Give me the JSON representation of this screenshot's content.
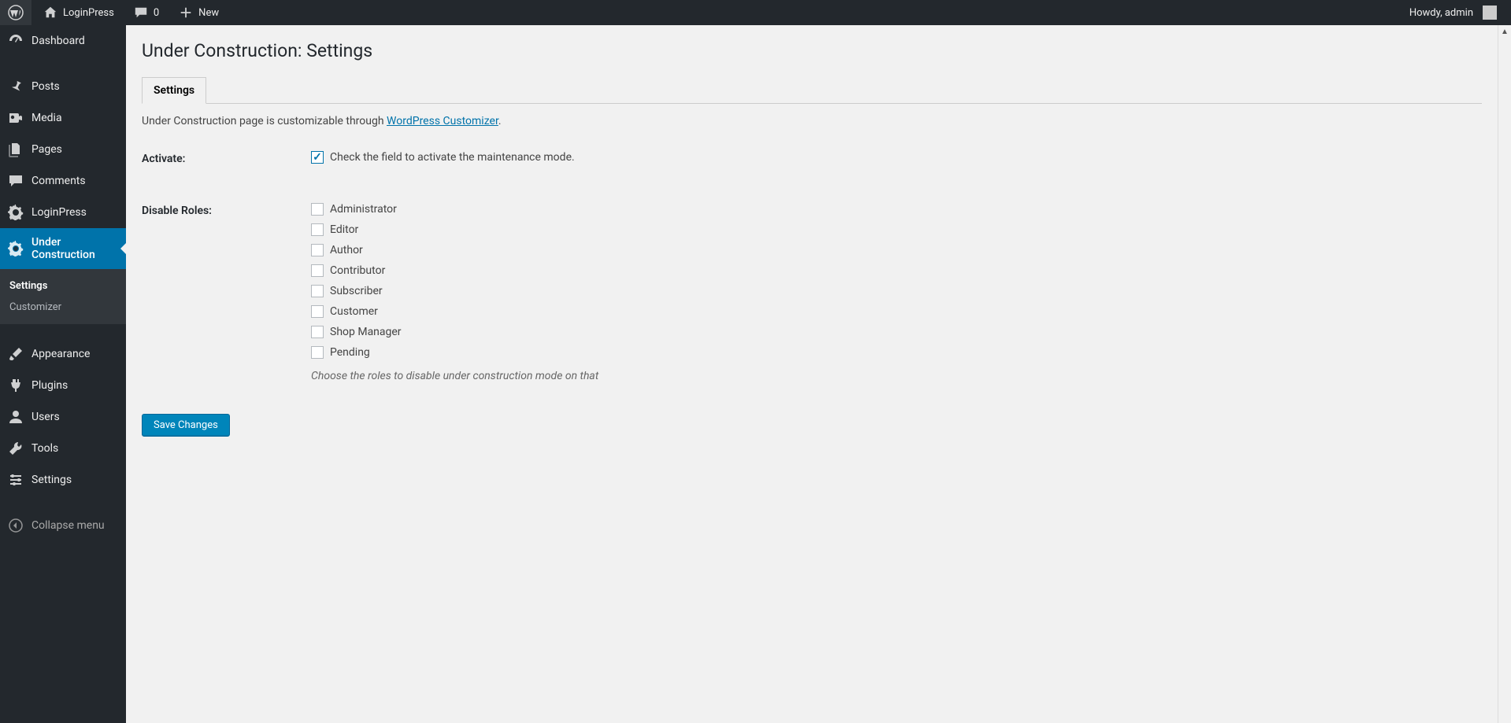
{
  "adminbar": {
    "site_name": "LoginPress",
    "comment_count": "0",
    "new_label": "New",
    "howdy": "Howdy, admin"
  },
  "sidebar": {
    "items": [
      {
        "label": "Dashboard",
        "icon": "dashboard",
        "slug": "dashboard"
      },
      {
        "label": "Posts",
        "icon": "pin",
        "slug": "posts"
      },
      {
        "label": "Media",
        "icon": "media",
        "slug": "media"
      },
      {
        "label": "Pages",
        "icon": "pages",
        "slug": "pages"
      },
      {
        "label": "Comments",
        "icon": "comment",
        "slug": "comments"
      },
      {
        "label": "LoginPress",
        "icon": "gear",
        "slug": "loginpress"
      },
      {
        "label": "Under Construction",
        "icon": "gear",
        "slug": "under-construction",
        "current": true
      },
      {
        "label": "Appearance",
        "icon": "brush",
        "slug": "appearance"
      },
      {
        "label": "Plugins",
        "icon": "plugin",
        "slug": "plugins"
      },
      {
        "label": "Users",
        "icon": "users",
        "slug": "users"
      },
      {
        "label": "Tools",
        "icon": "tools",
        "slug": "tools"
      },
      {
        "label": "Settings",
        "icon": "settings",
        "slug": "settings"
      }
    ],
    "submenu": [
      {
        "label": "Settings",
        "current": true
      },
      {
        "label": "Customizer",
        "current": false
      }
    ],
    "collapse_label": "Collapse menu"
  },
  "page": {
    "title": "Under Construction: Settings",
    "tabs": [
      {
        "label": "Settings",
        "active": true
      }
    ],
    "intro_prefix": "Under Construction page is customizable through ",
    "intro_link_text": "WordPress Customizer",
    "intro_suffix": ".",
    "form": {
      "activate": {
        "label": "Activate:",
        "checked": true,
        "text": "Check the field to activate the maintenance mode."
      },
      "roles": {
        "label": "Disable Roles:",
        "options": [
          {
            "label": "Administrator",
            "checked": false
          },
          {
            "label": "Editor",
            "checked": false
          },
          {
            "label": "Author",
            "checked": false
          },
          {
            "label": "Contributor",
            "checked": false
          },
          {
            "label": "Subscriber",
            "checked": false
          },
          {
            "label": "Customer",
            "checked": false
          },
          {
            "label": "Shop Manager",
            "checked": false
          },
          {
            "label": "Pending",
            "checked": false
          }
        ],
        "help": "Choose the roles to disable under construction mode on that"
      },
      "submit_label": "Save Changes"
    }
  }
}
